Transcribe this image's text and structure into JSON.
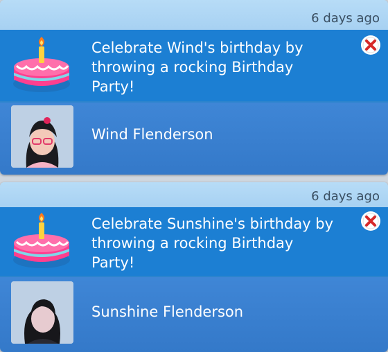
{
  "notifications": [
    {
      "timestamp": "6 days ago",
      "message": "Celebrate Wind's birthday by throwing a rocking Birthday Party!",
      "sim_name": "Wind Flenderson",
      "icon": "birthday-cake-icon"
    },
    {
      "timestamp": "6 days ago",
      "message": "Celebrate Sunshine's birthday by throwing a rocking Birthday Party!",
      "sim_name": "Sunshine Flenderson",
      "icon": "birthday-cake-icon"
    }
  ],
  "colors": {
    "header": "#a9d3f3",
    "message_row": "#1c7fd3",
    "sim_row": "#3a80d0",
    "close_red": "#d62828"
  }
}
